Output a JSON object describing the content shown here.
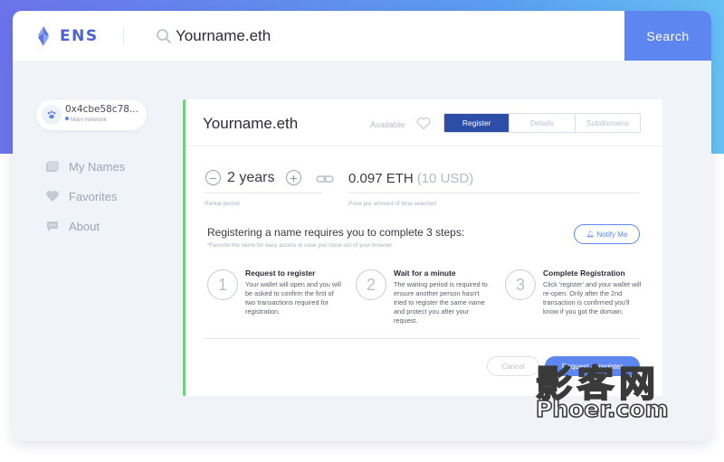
{
  "app": {
    "logo_text": "ENS",
    "brand_color": "#4c62d8",
    "accent_color": "#5e86f0",
    "success_color": "#6fd27a"
  },
  "search": {
    "value": "Yourname.eth",
    "button_label": "Search"
  },
  "account": {
    "address": "0x4cbe58c78...",
    "network": "Main Network"
  },
  "sidebar": {
    "items": [
      {
        "label": "My Names",
        "icon": "folder-icon"
      },
      {
        "label": "Favorites",
        "icon": "heart-icon"
      },
      {
        "label": "About",
        "icon": "chat-icon"
      }
    ]
  },
  "domain": {
    "name": "Yourname.eth",
    "status": "Available",
    "tabs": [
      {
        "label": "Register",
        "active": true
      },
      {
        "label": "Details",
        "active": false
      },
      {
        "label": "Subdomains",
        "active": false
      }
    ]
  },
  "registration": {
    "years": "2 years",
    "rental_label": "Rental period",
    "price_eth": "0.097 ETH",
    "price_usd": "(10 USD)",
    "price_label": "Price per amount of time selected",
    "steps_title": "Registering a name requires you to complete 3 steps:",
    "steps_subtitle": "*Favorite the name for easy access in case you close out of your browser.",
    "notify_label": "Notify Me",
    "steps": [
      {
        "number": "1",
        "title": "Request to register",
        "description": "Your wallet will open and you will be asked to confirm the first of two transactions required for registration."
      },
      {
        "number": "2",
        "title": "Wait for a minute",
        "description": "The waiting period is required to ensure another person hasn't tried to register the same name and protect you after your request."
      },
      {
        "number": "3",
        "title": "Complete Registration",
        "description": "Click 'register' and your wallet will re-open. Only after the 2nd transaction is confirmed you'll know if you got the domain."
      }
    ],
    "cancel_label": "Cancel",
    "register_label": "Request to register"
  },
  "watermark": {
    "line1": "影客网",
    "line2": "Phoer.com"
  }
}
